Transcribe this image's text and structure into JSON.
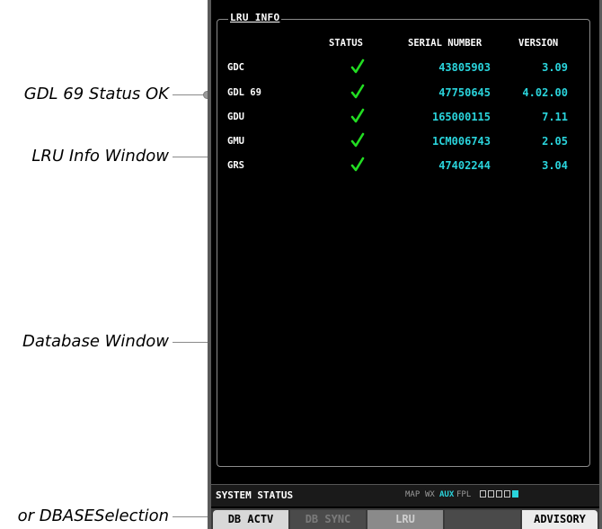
{
  "callouts": {
    "gdl_status": "GDL 69 Status OK",
    "lru_window": "LRU Info Window",
    "database_window": "Database Window",
    "db_selection": "or DBASESelection"
  },
  "lru_info": {
    "title": "LRU INFO",
    "headers": {
      "status": "STATUS",
      "serial": "SERIAL NUMBER",
      "version": "VERSION"
    },
    "rows": [
      {
        "name": "GDC",
        "status": "ok",
        "serial": "43805903",
        "version": "3.09"
      },
      {
        "name": "GDL 69",
        "status": "ok",
        "serial": "47750645",
        "version": "4.02.00"
      },
      {
        "name": "GDU",
        "status": "ok",
        "serial": "165000115",
        "version": "7.11"
      },
      {
        "name": "GMU",
        "status": "ok",
        "serial": "1CM006743",
        "version": "2.05"
      },
      {
        "name": "GRS",
        "status": "ok",
        "serial": "47402244",
        "version": "3.04"
      }
    ]
  },
  "status_bar": {
    "title": "SYSTEM STATUS",
    "page_groups": {
      "map": "MAP",
      "wx": "WX",
      "aux": "AUX",
      "fpl": "FPL"
    },
    "active_group": "AUX",
    "page_indicator_count": 5,
    "page_indicator_active": 5
  },
  "softkeys": {
    "db_actv": "DB ACTV",
    "db_sync": "DB SYNC",
    "lru": "LRU",
    "blank": "",
    "advisory": "ADVISORY"
  },
  "colors": {
    "screen_bg": "#000000",
    "value_cyan": "#2ad4dc",
    "check_green": "#22dd22",
    "text_white": "#ffffff"
  },
  "icons": {
    "status_ok": "check-icon"
  }
}
